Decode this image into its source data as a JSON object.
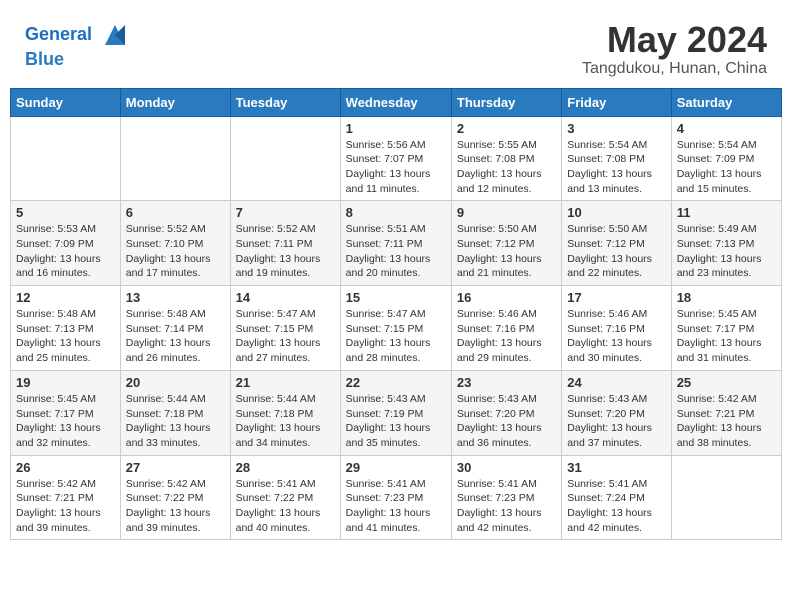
{
  "logo": {
    "line1": "General",
    "line2": "Blue"
  },
  "title": "May 2024",
  "location": "Tangdukou, Hunan, China",
  "weekdays": [
    "Sunday",
    "Monday",
    "Tuesday",
    "Wednesday",
    "Thursday",
    "Friday",
    "Saturday"
  ],
  "weeks": [
    [
      {
        "day": "",
        "info": ""
      },
      {
        "day": "",
        "info": ""
      },
      {
        "day": "",
        "info": ""
      },
      {
        "day": "1",
        "info": "Sunrise: 5:56 AM\nSunset: 7:07 PM\nDaylight: 13 hours\nand 11 minutes."
      },
      {
        "day": "2",
        "info": "Sunrise: 5:55 AM\nSunset: 7:08 PM\nDaylight: 13 hours\nand 12 minutes."
      },
      {
        "day": "3",
        "info": "Sunrise: 5:54 AM\nSunset: 7:08 PM\nDaylight: 13 hours\nand 13 minutes."
      },
      {
        "day": "4",
        "info": "Sunrise: 5:54 AM\nSunset: 7:09 PM\nDaylight: 13 hours\nand 15 minutes."
      }
    ],
    [
      {
        "day": "5",
        "info": "Sunrise: 5:53 AM\nSunset: 7:09 PM\nDaylight: 13 hours\nand 16 minutes."
      },
      {
        "day": "6",
        "info": "Sunrise: 5:52 AM\nSunset: 7:10 PM\nDaylight: 13 hours\nand 17 minutes."
      },
      {
        "day": "7",
        "info": "Sunrise: 5:52 AM\nSunset: 7:11 PM\nDaylight: 13 hours\nand 19 minutes."
      },
      {
        "day": "8",
        "info": "Sunrise: 5:51 AM\nSunset: 7:11 PM\nDaylight: 13 hours\nand 20 minutes."
      },
      {
        "day": "9",
        "info": "Sunrise: 5:50 AM\nSunset: 7:12 PM\nDaylight: 13 hours\nand 21 minutes."
      },
      {
        "day": "10",
        "info": "Sunrise: 5:50 AM\nSunset: 7:12 PM\nDaylight: 13 hours\nand 22 minutes."
      },
      {
        "day": "11",
        "info": "Sunrise: 5:49 AM\nSunset: 7:13 PM\nDaylight: 13 hours\nand 23 minutes."
      }
    ],
    [
      {
        "day": "12",
        "info": "Sunrise: 5:48 AM\nSunset: 7:13 PM\nDaylight: 13 hours\nand 25 minutes."
      },
      {
        "day": "13",
        "info": "Sunrise: 5:48 AM\nSunset: 7:14 PM\nDaylight: 13 hours\nand 26 minutes."
      },
      {
        "day": "14",
        "info": "Sunrise: 5:47 AM\nSunset: 7:15 PM\nDaylight: 13 hours\nand 27 minutes."
      },
      {
        "day": "15",
        "info": "Sunrise: 5:47 AM\nSunset: 7:15 PM\nDaylight: 13 hours\nand 28 minutes."
      },
      {
        "day": "16",
        "info": "Sunrise: 5:46 AM\nSunset: 7:16 PM\nDaylight: 13 hours\nand 29 minutes."
      },
      {
        "day": "17",
        "info": "Sunrise: 5:46 AM\nSunset: 7:16 PM\nDaylight: 13 hours\nand 30 minutes."
      },
      {
        "day": "18",
        "info": "Sunrise: 5:45 AM\nSunset: 7:17 PM\nDaylight: 13 hours\nand 31 minutes."
      }
    ],
    [
      {
        "day": "19",
        "info": "Sunrise: 5:45 AM\nSunset: 7:17 PM\nDaylight: 13 hours\nand 32 minutes."
      },
      {
        "day": "20",
        "info": "Sunrise: 5:44 AM\nSunset: 7:18 PM\nDaylight: 13 hours\nand 33 minutes."
      },
      {
        "day": "21",
        "info": "Sunrise: 5:44 AM\nSunset: 7:18 PM\nDaylight: 13 hours\nand 34 minutes."
      },
      {
        "day": "22",
        "info": "Sunrise: 5:43 AM\nSunset: 7:19 PM\nDaylight: 13 hours\nand 35 minutes."
      },
      {
        "day": "23",
        "info": "Sunrise: 5:43 AM\nSunset: 7:20 PM\nDaylight: 13 hours\nand 36 minutes."
      },
      {
        "day": "24",
        "info": "Sunrise: 5:43 AM\nSunset: 7:20 PM\nDaylight: 13 hours\nand 37 minutes."
      },
      {
        "day": "25",
        "info": "Sunrise: 5:42 AM\nSunset: 7:21 PM\nDaylight: 13 hours\nand 38 minutes."
      }
    ],
    [
      {
        "day": "26",
        "info": "Sunrise: 5:42 AM\nSunset: 7:21 PM\nDaylight: 13 hours\nand 39 minutes."
      },
      {
        "day": "27",
        "info": "Sunrise: 5:42 AM\nSunset: 7:22 PM\nDaylight: 13 hours\nand 39 minutes."
      },
      {
        "day": "28",
        "info": "Sunrise: 5:41 AM\nSunset: 7:22 PM\nDaylight: 13 hours\nand 40 minutes."
      },
      {
        "day": "29",
        "info": "Sunrise: 5:41 AM\nSunset: 7:23 PM\nDaylight: 13 hours\nand 41 minutes."
      },
      {
        "day": "30",
        "info": "Sunrise: 5:41 AM\nSunset: 7:23 PM\nDaylight: 13 hours\nand 42 minutes."
      },
      {
        "day": "31",
        "info": "Sunrise: 5:41 AM\nSunset: 7:24 PM\nDaylight: 13 hours\nand 42 minutes."
      },
      {
        "day": "",
        "info": ""
      }
    ]
  ]
}
